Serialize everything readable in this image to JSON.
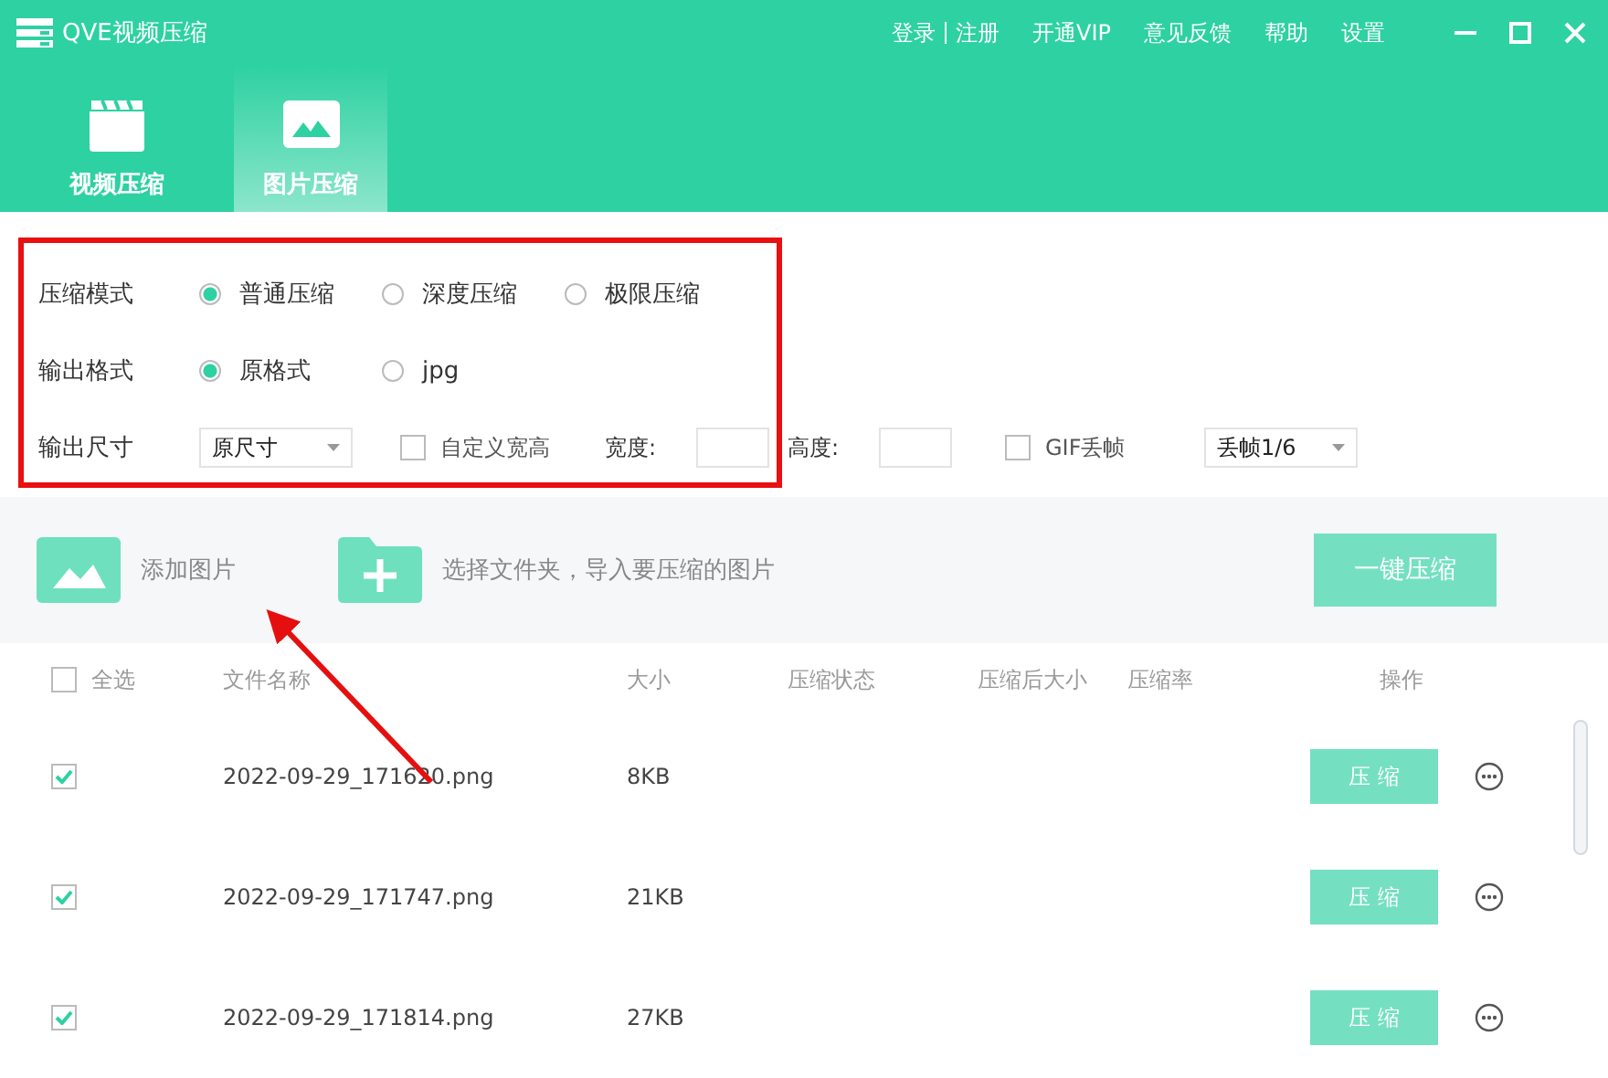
{
  "window": {
    "title": "QVE视频压缩",
    "menu": [
      "登录",
      "注册",
      "开通VIP",
      "意见反馈",
      "帮助",
      "设置"
    ]
  },
  "tabs": [
    {
      "label": "视频压缩",
      "kind": "video",
      "selected": false
    },
    {
      "label": "图片压缩",
      "kind": "image",
      "selected": true
    }
  ],
  "options": {
    "mode": {
      "label": "压缩模式",
      "choices": [
        {
          "label": "普通压缩",
          "selected": true
        },
        {
          "label": "深度压缩",
          "selected": false
        },
        {
          "label": "极限压缩",
          "selected": false
        }
      ]
    },
    "format": {
      "label": "输出格式",
      "choices": [
        {
          "label": "原格式",
          "selected": true
        },
        {
          "label": "jpg",
          "selected": false
        }
      ]
    },
    "size": {
      "label": "输出尺寸",
      "select": "原尺寸",
      "custom": {
        "label": "自定义宽高",
        "checked": false
      },
      "width_label": "宽度:",
      "height_label": "高度:",
      "gif": {
        "label": "GIF丢帧",
        "checked": false
      },
      "gif_select": "丢帧1/6"
    }
  },
  "toolbar": {
    "add_image": "添加图片",
    "add_folder": "选择文件夹，导入要压缩的图片",
    "compress_all": "一键压缩"
  },
  "table": {
    "select_all": {
      "label": "全选",
      "checked": false
    },
    "columns": [
      "文件名称",
      "大小",
      "压缩状态",
      "压缩后大小",
      "压缩率",
      "操作"
    ],
    "rows": [
      {
        "checked": true,
        "name": "2022-09-29_171620.png",
        "size": "8KB",
        "action": "压 缩"
      },
      {
        "checked": true,
        "name": "2022-09-29_171747.png",
        "size": "21KB",
        "action": "压 缩"
      },
      {
        "checked": true,
        "name": "2022-09-29_171814.png",
        "size": "27KB",
        "action": "压 缩"
      }
    ]
  }
}
